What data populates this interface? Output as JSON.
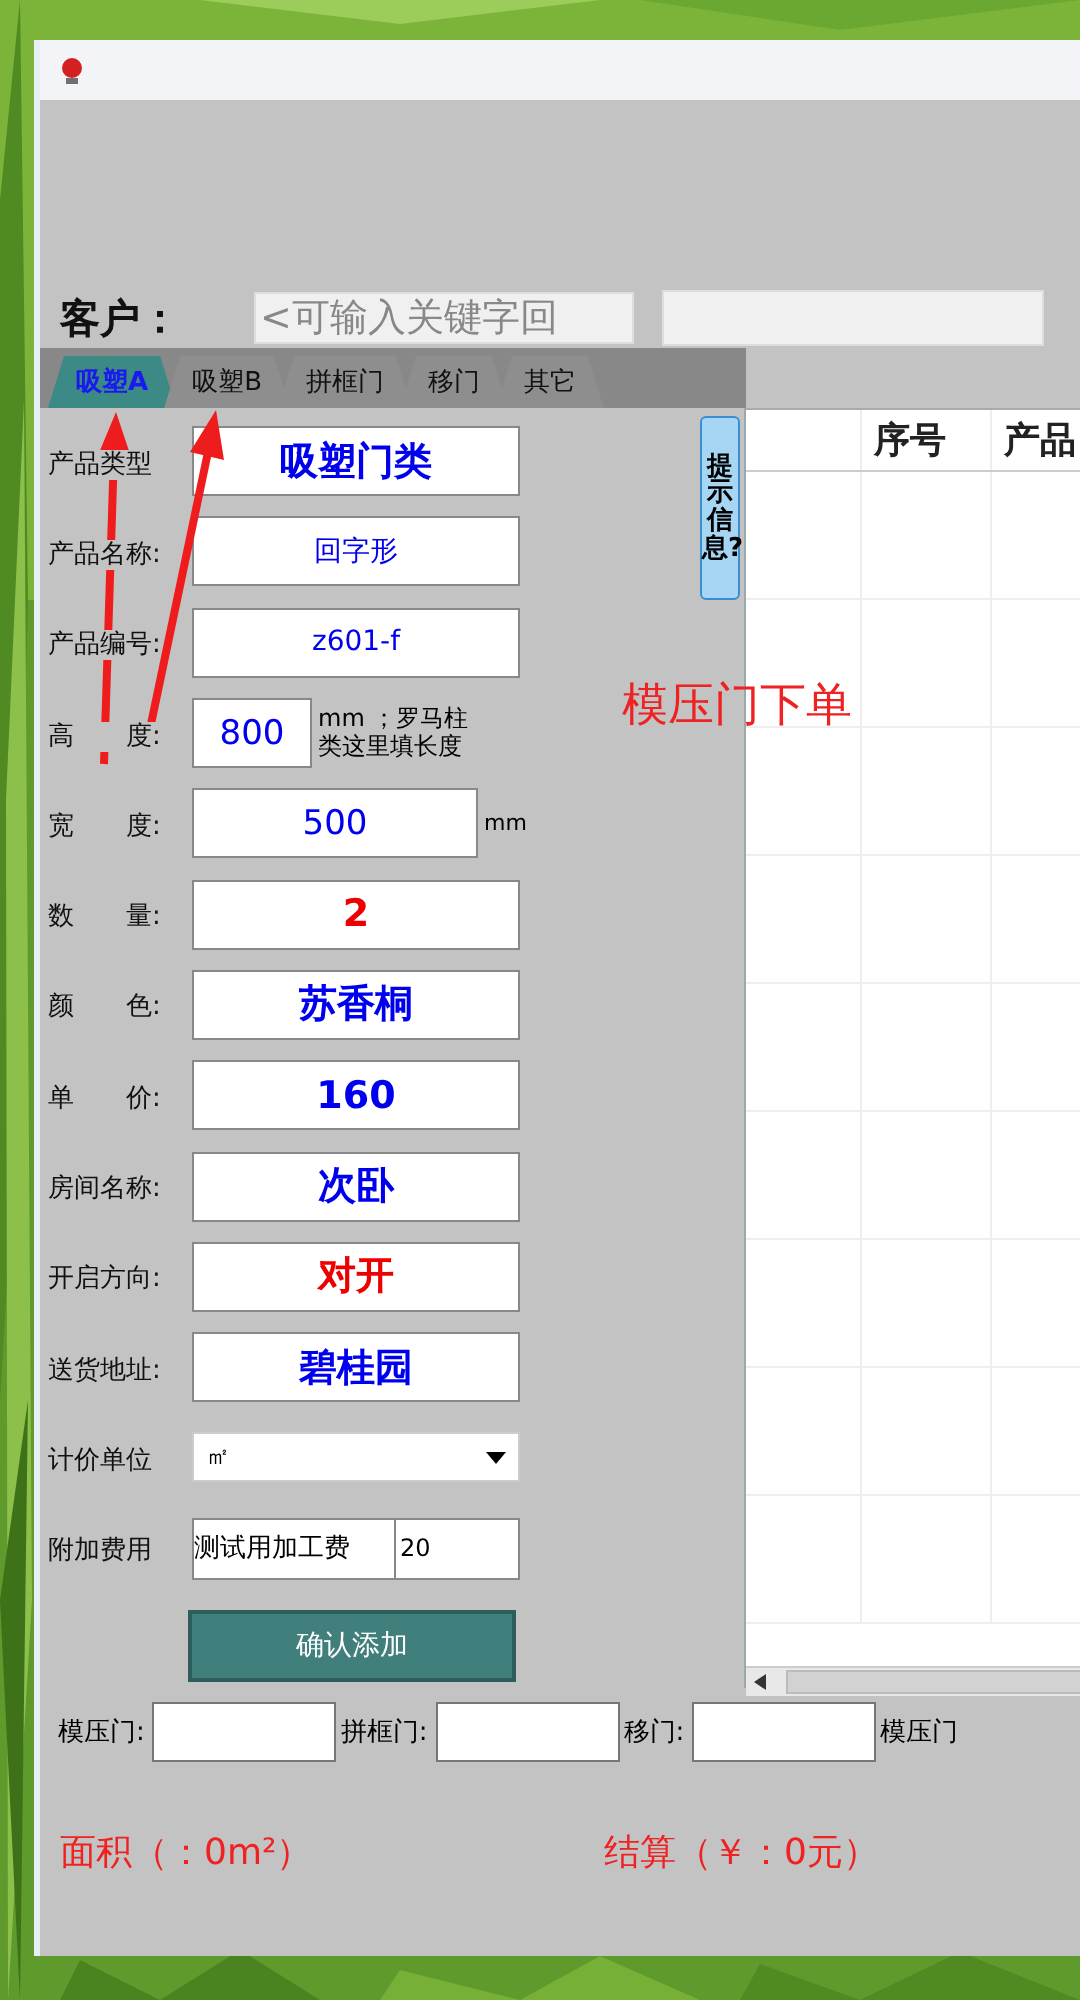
{
  "customer": {
    "label": "客户：",
    "placeholder": "<可输入关键字回"
  },
  "tabs": [
    {
      "label": "吸塑A",
      "selected": true
    },
    {
      "label": "吸塑B",
      "selected": false
    },
    {
      "label": "拼框门",
      "selected": false
    },
    {
      "label": "移门",
      "selected": false
    },
    {
      "label": "其它",
      "selected": false
    }
  ],
  "hint_button": "提示信息?",
  "form": [
    {
      "kind": "text",
      "label": "产品类型",
      "value": "吸塑门类",
      "bold": true,
      "color": "#0000ee"
    },
    {
      "kind": "text",
      "label": "产品名称:",
      "value": "回字形",
      "bold": false,
      "color": "#0000ee"
    },
    {
      "kind": "text",
      "label": "产品编号:",
      "value": "z601-f",
      "bold": false,
      "color": "#0000ee"
    },
    {
      "kind": "short",
      "label": "高　　度:",
      "value": "800",
      "bold": false,
      "color": "#0000ee",
      "note": "mm ；罗马柱类这里填长度"
    },
    {
      "kind": "medium",
      "label": "宽　　度:",
      "value": "500",
      "bold": false,
      "color": "#0000ee",
      "note": "mm"
    },
    {
      "kind": "text",
      "label": "数　　量:",
      "value": "2",
      "bold": true,
      "color": "#ee0000"
    },
    {
      "kind": "text",
      "label": "颜　　色:",
      "value": "苏香桐",
      "bold": true,
      "color": "#0000ee"
    },
    {
      "kind": "text",
      "label": "单　　价:",
      "value": "160",
      "bold": true,
      "color": "#0000ee"
    },
    {
      "kind": "text",
      "label": "房间名称:",
      "value": "次卧",
      "bold": true,
      "color": "#0000ee"
    },
    {
      "kind": "text",
      "label": "开启方向:",
      "value": "对开",
      "bold": true,
      "color": "#ee0000"
    },
    {
      "kind": "text",
      "label": "送货地址:",
      "value": "碧桂园",
      "bold": true,
      "color": "#0000ee"
    },
    {
      "kind": "dropdown",
      "label": "计价单位",
      "value": "㎡"
    },
    {
      "kind": "pair",
      "label": "附加费用",
      "value": "测试用加工费",
      "value2": "20"
    }
  ],
  "confirm_button": "确认添加",
  "annotation": "模压门下单",
  "table": {
    "columns": [
      "序号",
      "产品"
    ]
  },
  "bottom_fields": [
    {
      "label": "模压门:"
    },
    {
      "label": "拼框门:"
    },
    {
      "label": "移门:"
    },
    {
      "label": "模压门"
    }
  ],
  "totals": {
    "area": "面积（：0m²）",
    "amount": "结算（￥：0元）"
  }
}
